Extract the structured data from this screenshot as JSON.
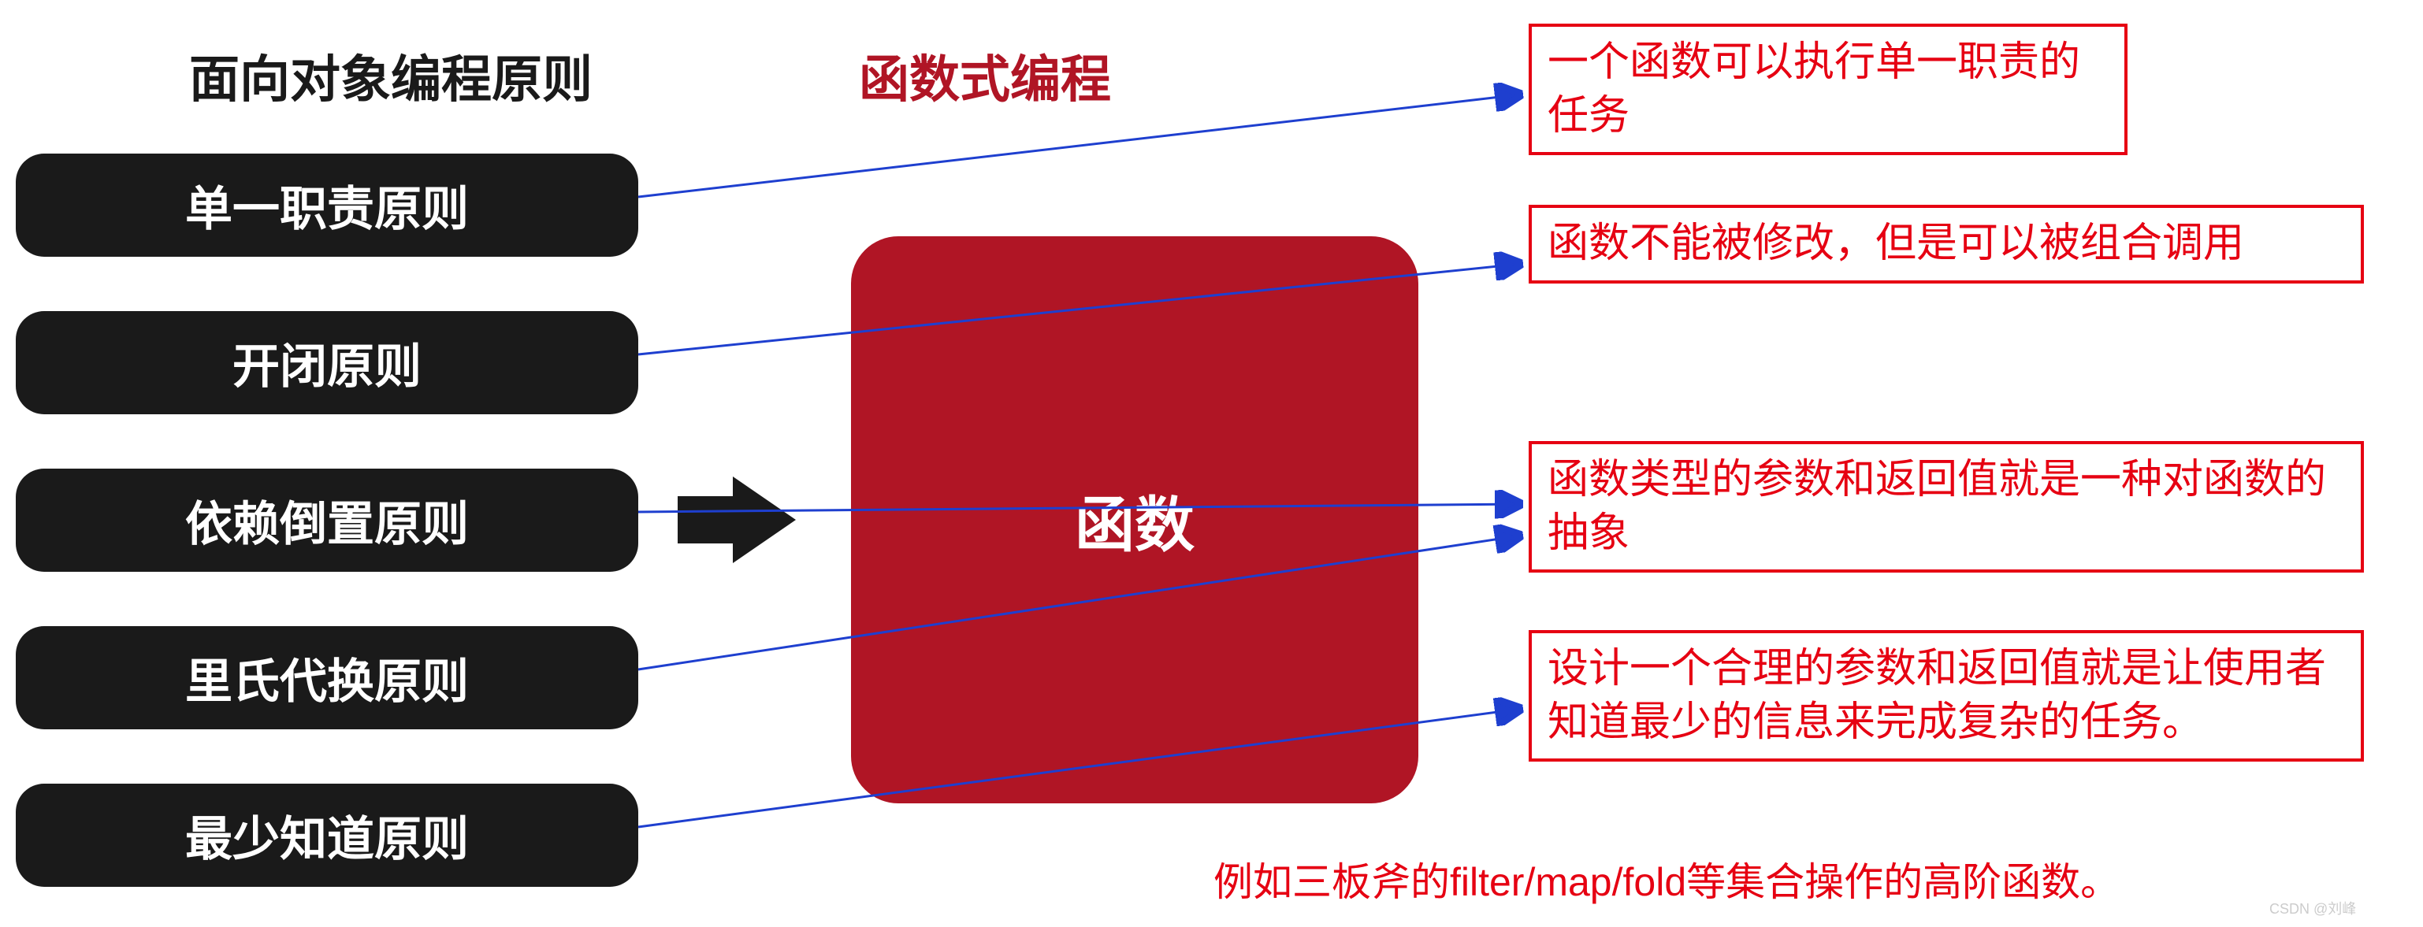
{
  "headings": {
    "left": "面向对象编程原则",
    "right": "函数式编程"
  },
  "principles": [
    "单一职责原则",
    "开闭原则",
    "依赖倒置原则",
    "里氏代换原则",
    "最少知道原则"
  ],
  "center_box": "函数",
  "notes": [
    "一个函数可以执行单一职责的任务",
    "函数不能被修改，但是可以被组合调用",
    "函数类型的参数和返回值就是一种对函数的抽象",
    "设计一个合理的参数和返回值就是让使用者知道最少的信息来完成复杂的任务。"
  ],
  "footer": "例如三板斧的filter/map/fold等集合操作的高阶函数。",
  "watermark": "CSDN @刘峰"
}
